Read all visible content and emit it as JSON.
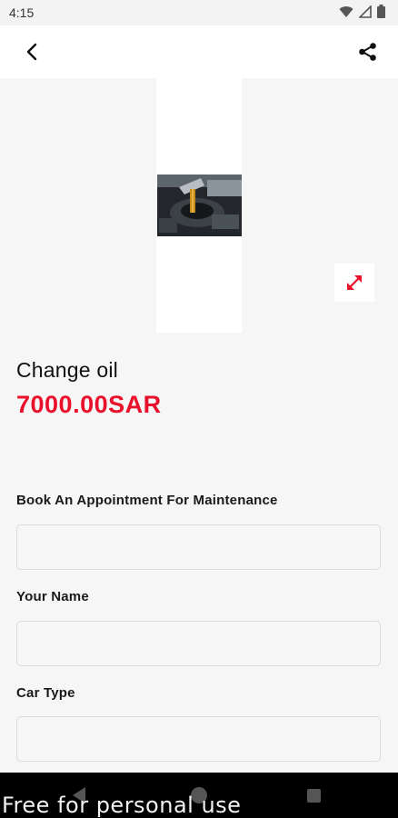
{
  "status_bar": {
    "time": "4:15"
  },
  "app_bar": {},
  "product": {
    "title": "Change oil",
    "price": "7000.00SAR"
  },
  "form": {
    "fields": [
      {
        "label": "Book An Appointment For Maintenance",
        "value": ""
      },
      {
        "label": "Your Name",
        "value": ""
      },
      {
        "label": "Car Type",
        "value": ""
      }
    ]
  },
  "colors": {
    "accent": "#e8102b"
  },
  "icons": {
    "back": "back-arrow-icon",
    "share": "share-icon",
    "expand": "expand-icon"
  },
  "watermark": "Free for personal use"
}
